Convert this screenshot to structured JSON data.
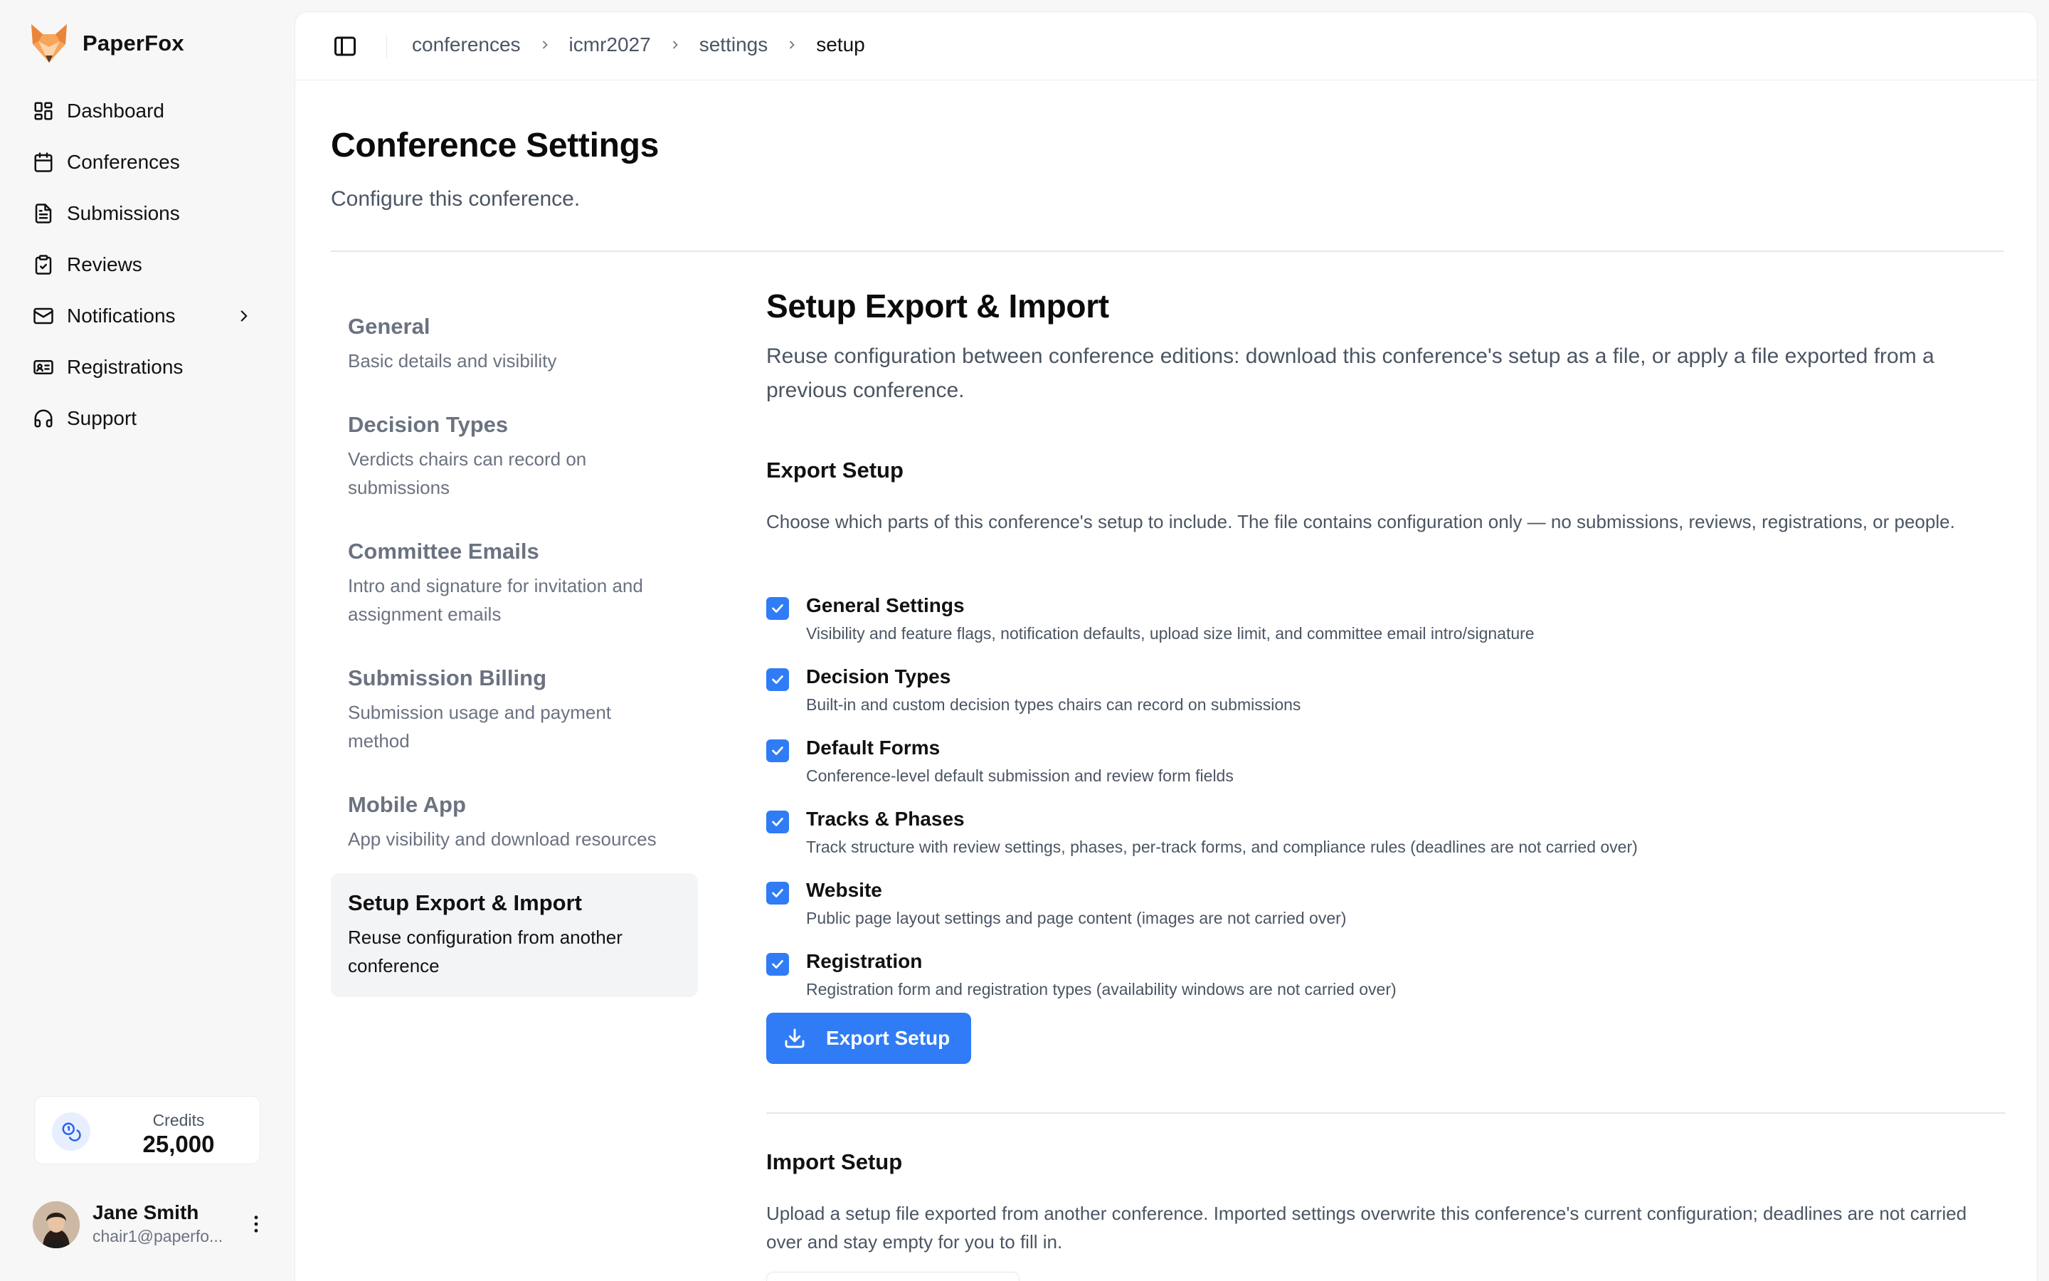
{
  "brand": {
    "name": "PaperFox"
  },
  "sidebar": {
    "items": [
      {
        "label": "Dashboard",
        "icon": "dashboard-icon"
      },
      {
        "label": "Conferences",
        "icon": "calendar-icon"
      },
      {
        "label": "Submissions",
        "icon": "document-icon"
      },
      {
        "label": "Reviews",
        "icon": "clipboard-check-icon"
      },
      {
        "label": "Notifications",
        "icon": "mail-icon"
      },
      {
        "label": "Registrations",
        "icon": "id-card-icon"
      },
      {
        "label": "Support",
        "icon": "headset-icon"
      }
    ]
  },
  "credits": {
    "label": "Credits",
    "value": "25,000"
  },
  "user": {
    "name": "Jane Smith",
    "email": "chair1@paperfo..."
  },
  "breadcrumb": [
    "conferences",
    "icmr2027",
    "settings",
    "setup"
  ],
  "page": {
    "title": "Conference Settings",
    "subtitle": "Configure this conference."
  },
  "settings_nav": [
    {
      "title": "General",
      "desc": "Basic details and visibility"
    },
    {
      "title": "Decision Types",
      "desc": "Verdicts chairs can record on submissions"
    },
    {
      "title": "Committee Emails",
      "desc": "Intro and signature for invitation and assignment emails"
    },
    {
      "title": "Submission Billing",
      "desc": "Submission usage and payment method"
    },
    {
      "title": "Mobile App",
      "desc": "App visibility and download resources"
    },
    {
      "title": "Setup Export & Import",
      "desc": "Reuse configuration from another conference",
      "active": true
    }
  ],
  "content": {
    "title": "Setup Export & Import",
    "desc": "Reuse configuration between conference editions: download this conference's setup as a file, or apply a file exported from a previous conference.",
    "export": {
      "title": "Export Setup",
      "desc": "Choose which parts of this conference's setup to include. The file contains configuration only — no submissions, reviews, registrations, or people.",
      "options": [
        {
          "title": "General Settings",
          "desc": "Visibility and feature flags, notification defaults, upload size limit, and committee email intro/signature",
          "checked": true
        },
        {
          "title": "Decision Types",
          "desc": "Built-in and custom decision types chairs can record on submissions",
          "checked": true
        },
        {
          "title": "Default Forms",
          "desc": "Conference-level default submission and review form fields",
          "checked": true
        },
        {
          "title": "Tracks & Phases",
          "desc": "Track structure with review settings, phases, per-track forms, and compliance rules (deadlines are not carried over)",
          "checked": true
        },
        {
          "title": "Website",
          "desc": "Public page layout settings and page content (images are not carried over)",
          "checked": true
        },
        {
          "title": "Registration",
          "desc": "Registration form and registration types (availability windows are not carried over)",
          "checked": true
        }
      ],
      "button": "Export Setup"
    },
    "import": {
      "title": "Import Setup",
      "desc": "Upload a setup file exported from another conference. Imported settings overwrite this conference's current configuration; deadlines are not carried over and stay empty for you to fill in."
    }
  },
  "colors": {
    "accent": "#2f7cf6",
    "brand_orange": "#f39a4a"
  }
}
